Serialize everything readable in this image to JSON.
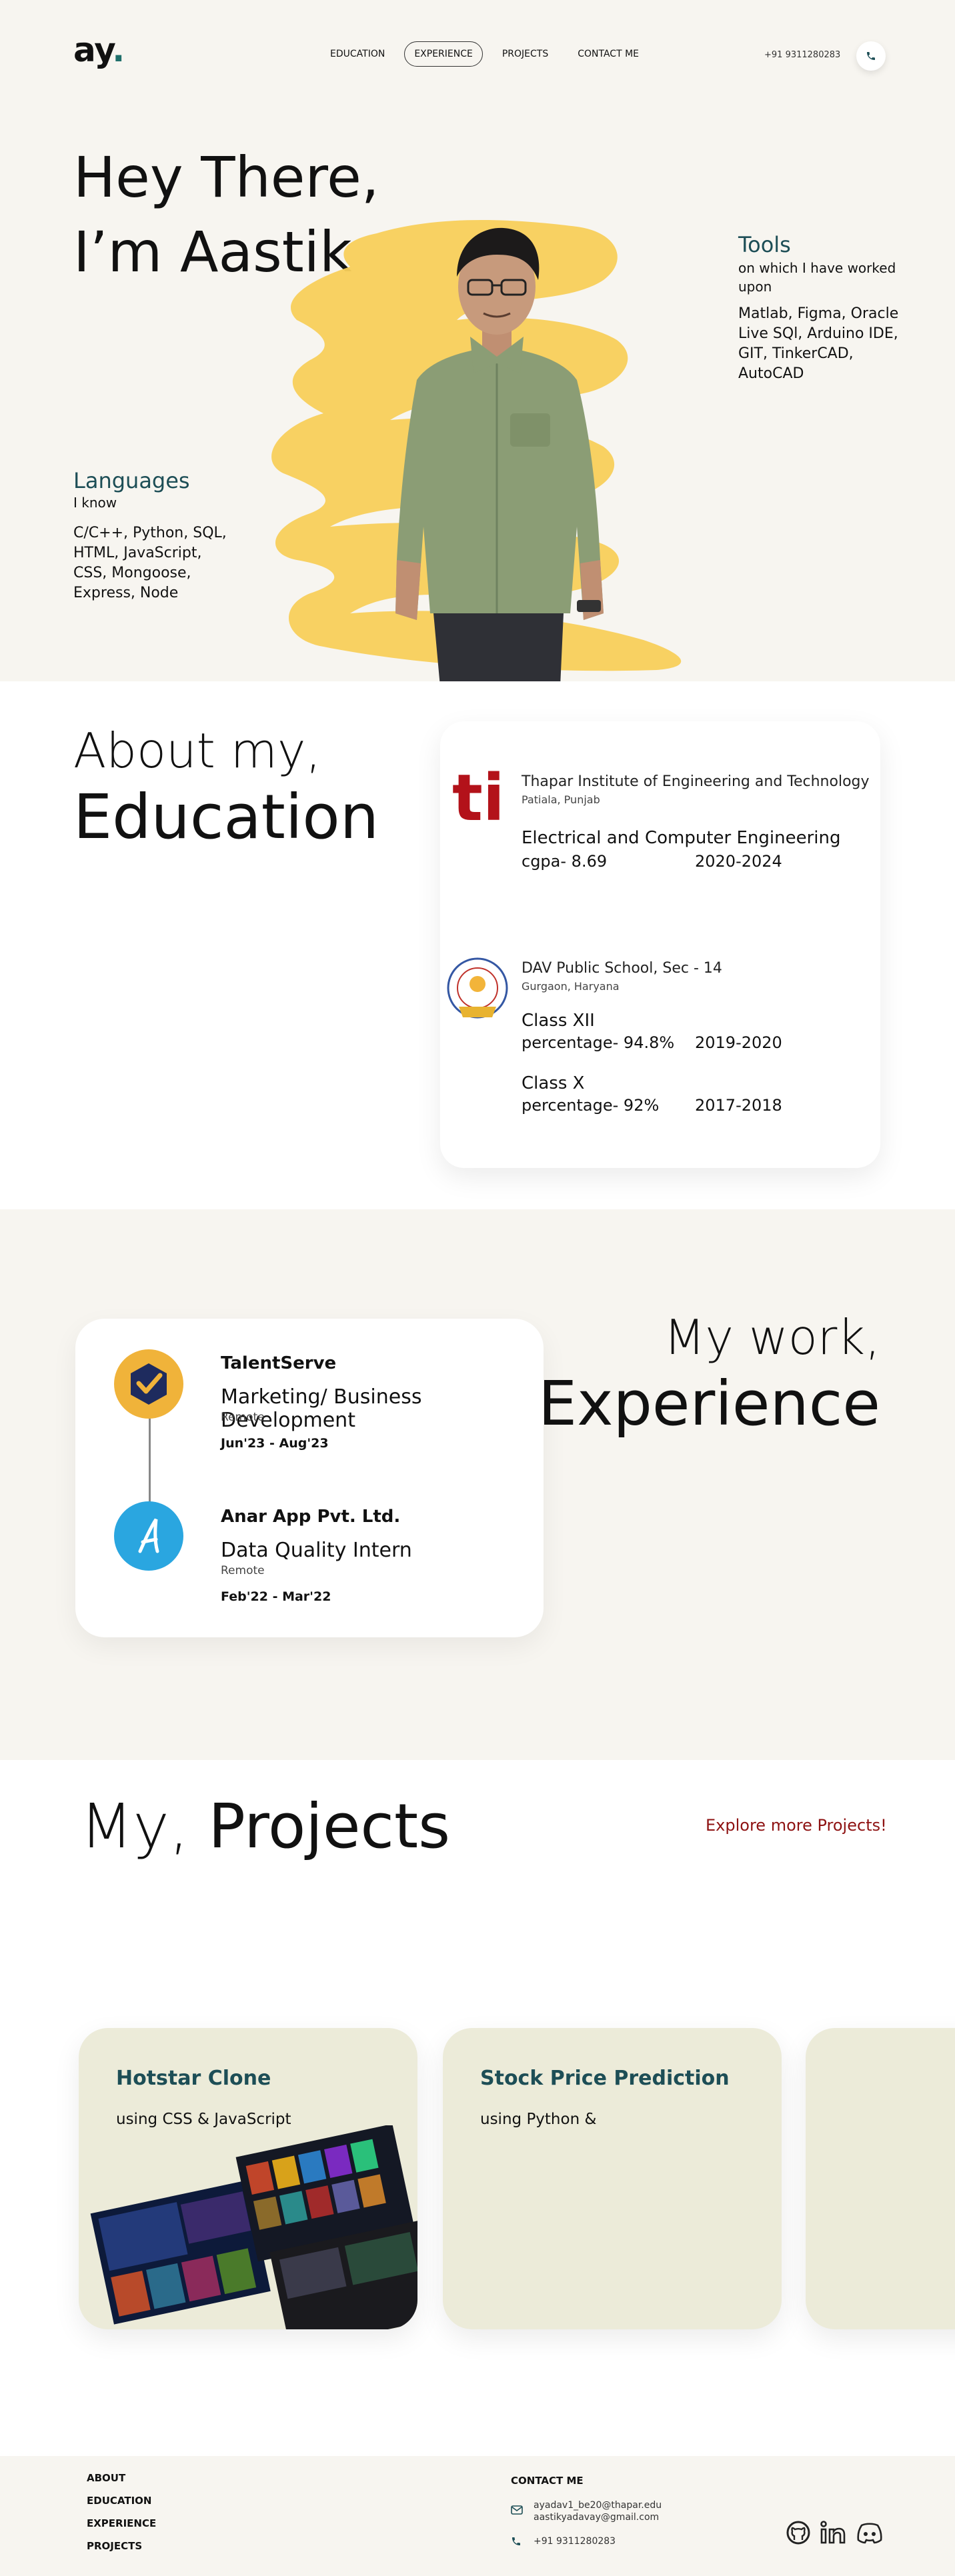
{
  "nav": {
    "logo": "ay",
    "logo_dot": ".",
    "links": [
      "EDUCATION",
      "EXPERIENCE",
      "PROJECTS",
      "CONTACT ME"
    ],
    "active": "EXPERIENCE",
    "phone": "+91 9311280283",
    "phone_icon": "phone-icon"
  },
  "hero": {
    "line1": "Hey There,",
    "line2": "I’m Aastik",
    "tools": {
      "title": "Tools",
      "subtitle": "on which I have worked upon",
      "list": "Matlab, Figma, Oracle Live SQl, Arduino IDE, GIT,  TinkerCAD, AutoCAD"
    },
    "languages": {
      "title": "Languages",
      "subtitle": "I know",
      "list": "C/C++, Python, SQL, HTML, JavaScript, CSS, Mongoose, Express, Node"
    }
  },
  "education": {
    "heading_small": "About my,",
    "heading_big": "Education",
    "entries": [
      {
        "institution": "Thapar Institute of Engineering and Technology",
        "location": "Patiala, Punjab",
        "degree": "Electrical and Computer Engineering",
        "grade_label": "cgpa- ",
        "grade": "8.69",
        "years": "2020-2024",
        "logo_text": "ti"
      },
      {
        "institution": "DAV Public School, Sec - 14",
        "location": "Gurgaon, Haryana",
        "classes": [
          {
            "name": "Class XII",
            "grade_label": "percentage- ",
            "grade": "94.8%",
            "years": "2019-2020"
          },
          {
            "name": "Class X",
            "grade_label": "percentage- ",
            "grade": "92%",
            "years": "2017-2018"
          }
        ]
      }
    ]
  },
  "experience": {
    "heading_small": "My work,",
    "heading_big": "Experience",
    "jobs": [
      {
        "company": "TalentServe",
        "role": "Marketing/ Business Development",
        "mode": "Remote",
        "dates": "Jun'23 - Aug'23",
        "logo_color": "#f0b33a"
      },
      {
        "company": "Anar App Pvt. Ltd.",
        "role": "Data Quality Intern",
        "mode": "Remote",
        "dates": "Feb'22 - Mar'22",
        "logo_color": "#2aa6e0"
      }
    ]
  },
  "projects": {
    "heading_light": "My, ",
    "heading_bold": "Projects",
    "explore": "Explore more Projects!",
    "cards": [
      {
        "title": "Hotstar Clone",
        "desc": "using CSS & JavaScript"
      },
      {
        "title": "Stock Price Prediction",
        "desc": "using Python &"
      },
      {
        "title": "",
        "desc": ""
      }
    ]
  },
  "footer": {
    "links": [
      "ABOUT",
      "EDUCATION",
      "EXPERIENCE",
      "PROJECTS"
    ],
    "contact_title": "CONTACT ME",
    "email1": "ayadav1_be20@thapar.edu",
    "email2": "aastikyadavay@gmail.com",
    "phone": "+91 9311280283",
    "social_icons": [
      "github-icon",
      "linkedin-icon",
      "discord-icon"
    ]
  },
  "colors": {
    "teal": "#1d4e56",
    "accent_red": "#8e1212",
    "brush_yellow": "#f8cf5a",
    "card_beige": "#ecebd9"
  }
}
